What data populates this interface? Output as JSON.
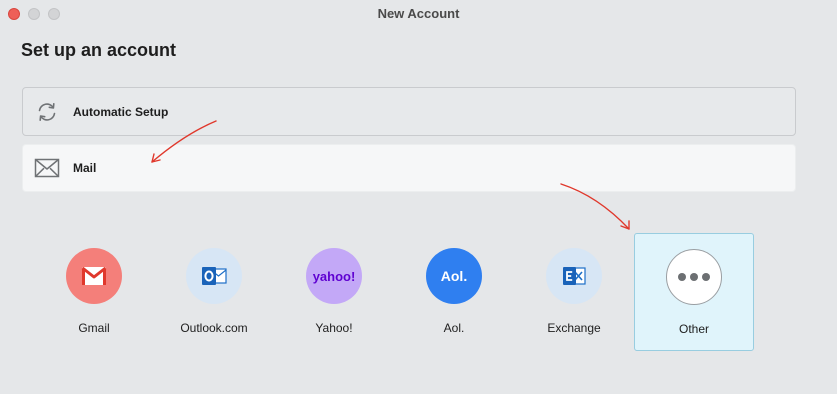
{
  "window": {
    "title": "New Account"
  },
  "page": {
    "title": "Set up an account"
  },
  "options": [
    {
      "label": "Automatic Setup",
      "icon": "sync-icon"
    },
    {
      "label": "Mail",
      "icon": "envelope-icon"
    }
  ],
  "providers": [
    {
      "label": "Gmail",
      "icon": "gmail-icon",
      "color": "#f47f7a"
    },
    {
      "label": "Outlook.com",
      "icon": "outlook-icon",
      "color": "#d7e6f5"
    },
    {
      "label": "Yahoo!",
      "icon": "yahoo-icon",
      "logo_text": "yahoo!",
      "color": "#c3a8f7"
    },
    {
      "label": "Aol.",
      "icon": "aol-icon",
      "logo_text": "Aol.",
      "color": "#2f7ff0"
    },
    {
      "label": "Exchange",
      "icon": "exchange-icon",
      "color": "#d7e6f5"
    },
    {
      "label": "Other",
      "icon": "more-icon",
      "selected": true,
      "color": "#ffffff"
    }
  ],
  "colors": {
    "annotation_arrow": "#e0382c",
    "selection_background": "#e0f4fb",
    "selection_border": "#98cde0"
  }
}
